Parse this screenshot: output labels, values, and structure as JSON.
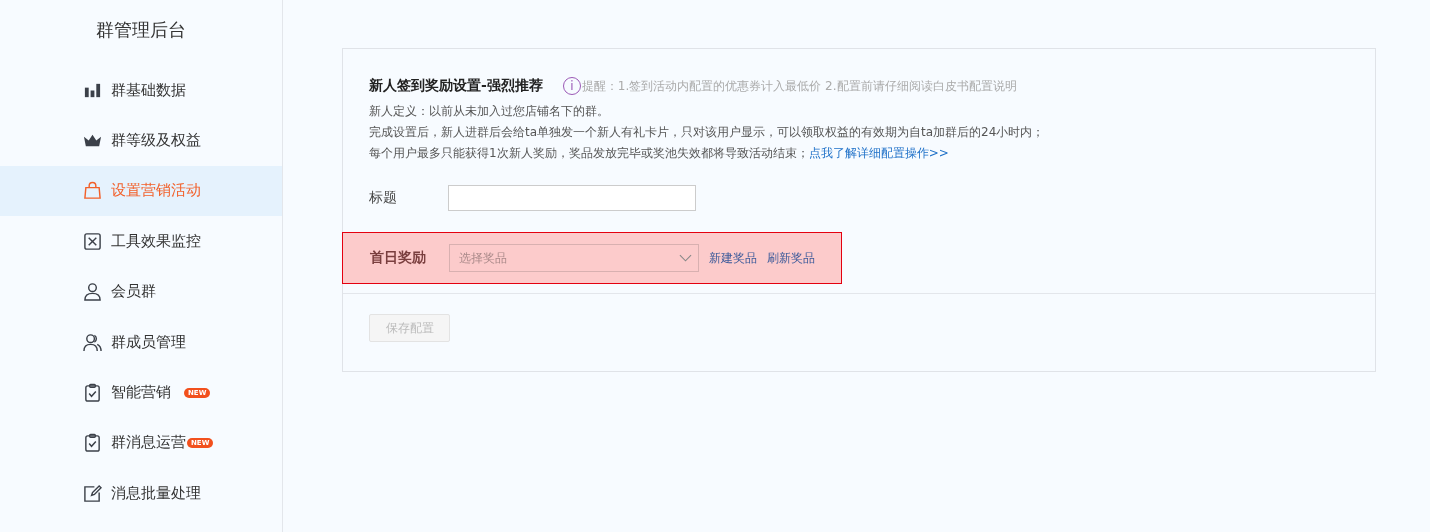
{
  "sidebar": {
    "title": "群管理后台",
    "items": [
      {
        "label": "群基础数据",
        "kind": "bars",
        "selected": false
      },
      {
        "label": "群等级及权益",
        "kind": "crown",
        "selected": false
      },
      {
        "label": "设置营销活动",
        "kind": "bag",
        "selected": true
      },
      {
        "label": "工具效果监控",
        "kind": "monitor",
        "selected": false
      },
      {
        "label": "会员群",
        "kind": "person",
        "selected": false
      },
      {
        "label": "群成员管理",
        "kind": "people",
        "selected": false
      },
      {
        "label": "智能营销",
        "kind": "clipboard",
        "selected": false,
        "badge": "NEW"
      },
      {
        "label": "群消息运营",
        "kind": "clipboard",
        "selected": false,
        "badge": "NEW"
      },
      {
        "label": "消息批量处理",
        "kind": "edit",
        "selected": false
      }
    ]
  },
  "panel": {
    "title": "新人签到奖励设置-强烈推荐",
    "tip_icon": "i",
    "tip": "提醒：1.签到活动内配置的优惠券计入最低价 2.配置前请仔细阅读白皮书配置说明",
    "description": [
      "新人定义：以前从未加入过您店铺名下的群。",
      "完成设置后，新人进群后会给ta单独发一个新人有礼卡片，只对该用户显示，可以领取权益的有效期为自ta加群后的24小时内；",
      "每个用户最多只能获得1次新人奖励，奖品发放完毕或奖池失效都将导致活动结束；"
    ],
    "link": "点我了解详细配置操作>>",
    "title_field": {
      "label": "标题"
    },
    "reward": {
      "label": "首日奖励",
      "placeholder": "选择奖品",
      "highlighted": true,
      "actions": [
        "新建奖品",
        "刷新奖品"
      ]
    },
    "save_button": {
      "label": "保存配置",
      "disabled": true
    }
  }
}
